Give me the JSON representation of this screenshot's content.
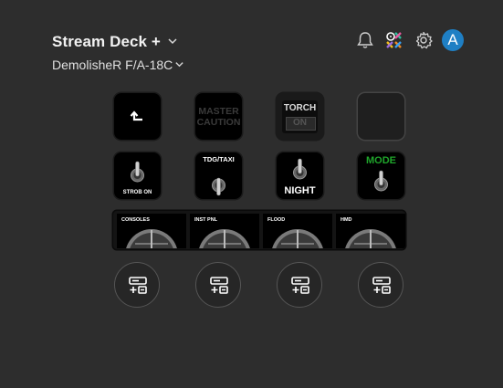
{
  "header": {
    "device_name": "Stream Deck +",
    "profile_name": "DemolisheR F/A-18C",
    "avatar_letter": "A",
    "icons": [
      "bell-icon",
      "marketplace-icon",
      "gear-icon",
      "avatar"
    ]
  },
  "keys": [
    {
      "name": "back",
      "icon": "back-arrow-icon"
    },
    {
      "name": "master-caution",
      "line1": "MASTER",
      "line2": "CAUTION"
    },
    {
      "name": "torch",
      "line1": "TORCH",
      "line2": "ON"
    },
    {
      "name": "empty"
    },
    {
      "name": "strob",
      "label": "STROB ON"
    },
    {
      "name": "tdg-taxi",
      "label": "TDG/TAXI"
    },
    {
      "name": "night",
      "label": "NIGHT"
    },
    {
      "name": "mode",
      "label": "MODE"
    }
  ],
  "dials": [
    {
      "label": "CONSOLES"
    },
    {
      "label": "INST PNL"
    },
    {
      "label": "FLOOD"
    },
    {
      "label": "HMD"
    }
  ],
  "colors": {
    "background": "#2d2d2d",
    "avatar": "#1f7fc4",
    "mode_green": "#1fa52b",
    "caution_text": "#3a3a3a"
  }
}
